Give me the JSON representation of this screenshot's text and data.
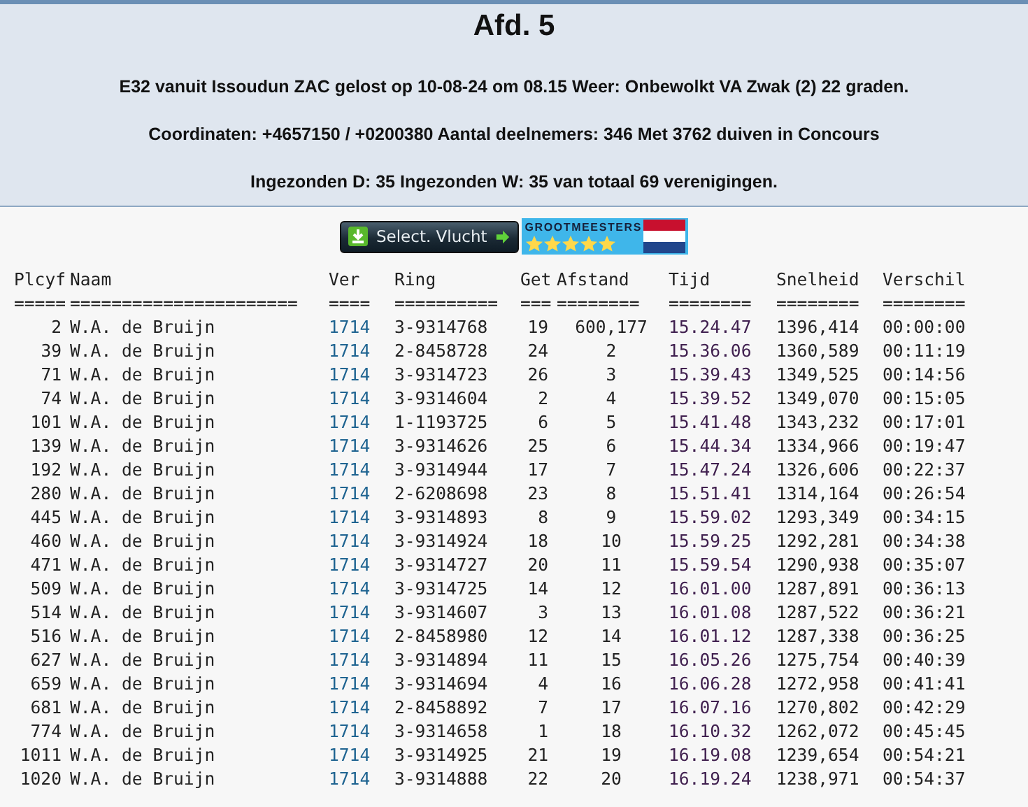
{
  "header": {
    "title": "Afd. 5",
    "lines": [
      "E32 vanuit Issoudun ZAC gelost op 10-08-24 om 08.15 Weer: Onbewolkt VA Zwak (2) 22 graden.",
      "Coordinaten: +4657150 / +0200380 Aantal deelnemers: 346 Met 3762 duiven in Concours",
      "Ingezonden D: 35 Ingezonden W: 35 van totaal 69 verenigingen."
    ]
  },
  "toolbar": {
    "select_button": "Select. Vlucht",
    "banner": "GROOTMEESTERS"
  },
  "table": {
    "columns": [
      {
        "label": "Plcyf",
        "rule": "=====",
        "kind": "num"
      },
      {
        "label": "Naam",
        "rule": "======================",
        "kind": "text"
      },
      {
        "label": "Ver",
        "rule": "====",
        "kind": "club"
      },
      {
        "label": "Ring",
        "rule": "==========",
        "kind": "text"
      },
      {
        "label": "Get",
        "rule": "===",
        "kind": "num"
      },
      {
        "label": "Afstand",
        "rule": "========",
        "kind": "center"
      },
      {
        "label": "Tijd",
        "rule": "========",
        "kind": "time"
      },
      {
        "label": "Snelheid",
        "rule": "========",
        "kind": "text"
      },
      {
        "label": "Verschil",
        "rule": "========",
        "kind": "text"
      }
    ],
    "rows": [
      [
        "2",
        "W.A. de Bruijn",
        "1714",
        "3-9314768",
        "19",
        "600,177",
        "15.24.47",
        "1396,414",
        "00:00:00"
      ],
      [
        "39",
        "W.A. de Bruijn",
        "1714",
        "2-8458728",
        "24",
        "2",
        "15.36.06",
        "1360,589",
        "00:11:19"
      ],
      [
        "71",
        "W.A. de Bruijn",
        "1714",
        "3-9314723",
        "26",
        "3",
        "15.39.43",
        "1349,525",
        "00:14:56"
      ],
      [
        "74",
        "W.A. de Bruijn",
        "1714",
        "3-9314604",
        "2",
        "4",
        "15.39.52",
        "1349,070",
        "00:15:05"
      ],
      [
        "101",
        "W.A. de Bruijn",
        "1714",
        "1-1193725",
        "6",
        "5",
        "15.41.48",
        "1343,232",
        "00:17:01"
      ],
      [
        "139",
        "W.A. de Bruijn",
        "1714",
        "3-9314626",
        "25",
        "6",
        "15.44.34",
        "1334,966",
        "00:19:47"
      ],
      [
        "192",
        "W.A. de Bruijn",
        "1714",
        "3-9314944",
        "17",
        "7",
        "15.47.24",
        "1326,606",
        "00:22:37"
      ],
      [
        "280",
        "W.A. de Bruijn",
        "1714",
        "2-6208698",
        "23",
        "8",
        "15.51.41",
        "1314,164",
        "00:26:54"
      ],
      [
        "445",
        "W.A. de Bruijn",
        "1714",
        "3-9314893",
        "8",
        "9",
        "15.59.02",
        "1293,349",
        "00:34:15"
      ],
      [
        "460",
        "W.A. de Bruijn",
        "1714",
        "3-9314924",
        "18",
        "10",
        "15.59.25",
        "1292,281",
        "00:34:38"
      ],
      [
        "471",
        "W.A. de Bruijn",
        "1714",
        "3-9314727",
        "20",
        "11",
        "15.59.54",
        "1290,938",
        "00:35:07"
      ],
      [
        "509",
        "W.A. de Bruijn",
        "1714",
        "3-9314725",
        "14",
        "12",
        "16.01.00",
        "1287,891",
        "00:36:13"
      ],
      [
        "514",
        "W.A. de Bruijn",
        "1714",
        "3-9314607",
        "3",
        "13",
        "16.01.08",
        "1287,522",
        "00:36:21"
      ],
      [
        "516",
        "W.A. de Bruijn",
        "1714",
        "2-8458980",
        "12",
        "14",
        "16.01.12",
        "1287,338",
        "00:36:25"
      ],
      [
        "627",
        "W.A. de Bruijn",
        "1714",
        "3-9314894",
        "11",
        "15",
        "16.05.26",
        "1275,754",
        "00:40:39"
      ],
      [
        "659",
        "W.A. de Bruijn",
        "1714",
        "3-9314694",
        "4",
        "16",
        "16.06.28",
        "1272,958",
        "00:41:41"
      ],
      [
        "681",
        "W.A. de Bruijn",
        "1714",
        "2-8458892",
        "7",
        "17",
        "16.07.16",
        "1270,802",
        "00:42:29"
      ],
      [
        "774",
        "W.A. de Bruijn",
        "1714",
        "3-9314658",
        "1",
        "18",
        "16.10.32",
        "1262,072",
        "00:45:45"
      ],
      [
        "1011",
        "W.A. de Bruijn",
        "1714",
        "3-9314925",
        "21",
        "19",
        "16.19.08",
        "1239,654",
        "00:54:21"
      ],
      [
        "1020",
        "W.A. de Bruijn",
        "1714",
        "3-9314888",
        "22",
        "20",
        "16.19.24",
        "1238,971",
        "00:54:37"
      ]
    ]
  }
}
